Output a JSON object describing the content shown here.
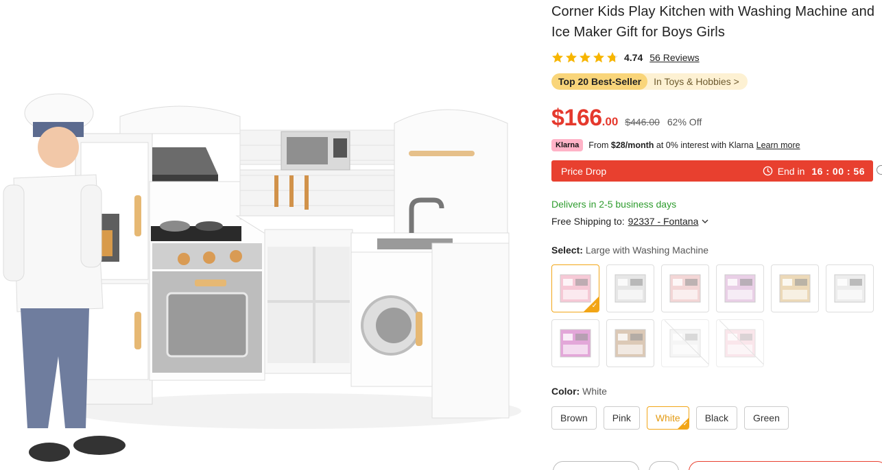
{
  "product": {
    "title": "Corner Kids Play Kitchen with Washing Machine and Ice Maker Gift for Boys Girls",
    "rating": "4.74",
    "rating_value": 4.74,
    "reviews_label": "56 Reviews"
  },
  "bestseller": {
    "badge": "Top 20 Best-Seller",
    "category": "In Toys & Hobbies >"
  },
  "price": {
    "main": "$166",
    "cents": ".00",
    "original": "$446.00",
    "discount": "62% Off"
  },
  "klarna": {
    "badge": "Klarna",
    "prefix": "From",
    "amount": "$28/month",
    "suffix": "at 0% interest with Klarna",
    "learn": "Learn more"
  },
  "price_drop": {
    "label": "Price Drop",
    "end_label": "End in",
    "time": "16 : 00 : 56"
  },
  "delivery": {
    "text": "Delivers in 2-5 business days",
    "shipping_label": "Free Shipping to:",
    "location": "92337 - Fontana"
  },
  "select": {
    "label": "Select:",
    "value": "Large with Washing Machine",
    "options": [
      {
        "tone": "#f6c9d6",
        "selected": true,
        "available": true
      },
      {
        "tone": "#e6e6e6",
        "selected": false,
        "available": true
      },
      {
        "tone": "#f3d6d6",
        "selected": false,
        "available": true
      },
      {
        "tone": "#e9cfe6",
        "selected": false,
        "available": true
      },
      {
        "tone": "#ecd9b8",
        "selected": false,
        "available": true
      },
      {
        "tone": "#ededed",
        "selected": false,
        "available": true
      },
      {
        "tone": "#e3a7d9",
        "selected": false,
        "available": true
      },
      {
        "tone": "#dcc9b6",
        "selected": false,
        "available": true
      },
      {
        "tone": "#eeeeee",
        "selected": false,
        "available": false
      },
      {
        "tone": "#f6d3dc",
        "selected": false,
        "available": false
      }
    ]
  },
  "color": {
    "label": "Color:",
    "value": "White",
    "options": [
      "Brown",
      "Pink",
      "White",
      "Black",
      "Green"
    ],
    "selected_index": 2
  },
  "theme": {
    "accent": "#e5392d",
    "selected_border": "#f2a516",
    "success": "#2e9c2e"
  }
}
